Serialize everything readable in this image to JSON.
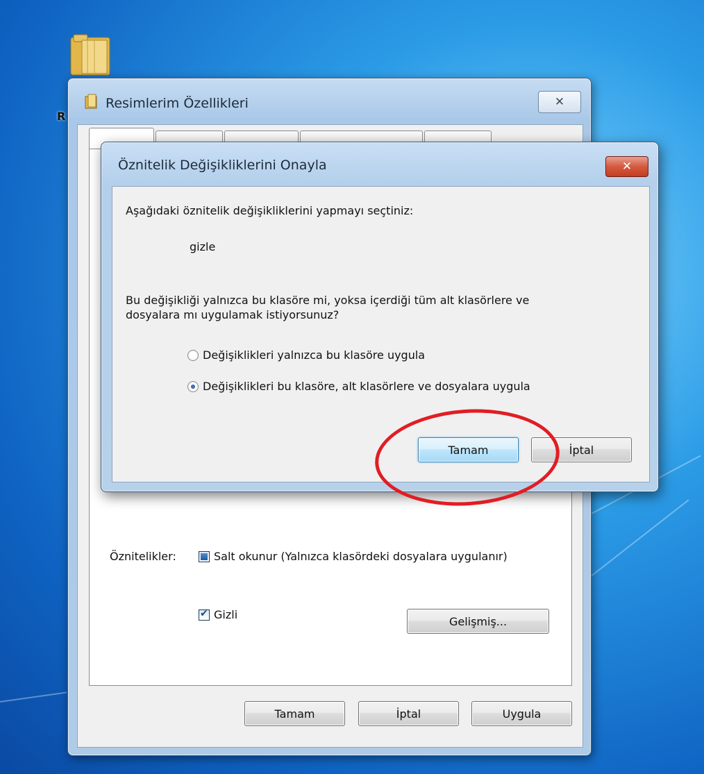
{
  "desktop": {
    "icon_label": "R"
  },
  "properties_window": {
    "title": "Resimlerim Özellikleri",
    "close_glyph": "✕",
    "attributes_label": "Öznitelikler:",
    "readonly_label": "Salt okunur (Yalnızca klasördeki dosyalara uygulanır)",
    "hidden_label": "Gizli",
    "advanced_label": "Gelişmiş...",
    "ok_label": "Tamam",
    "cancel_label": "İptal",
    "apply_label": "Uygula"
  },
  "confirm_dialog": {
    "title": "Öznitelik Değişikliklerini Onayla",
    "close_glyph": "✕",
    "intro": "Aşağıdaki öznitelik değişikliklerini yapmayı seçtiniz:",
    "change": "gizle",
    "question_line1": "Bu değişikliği yalnızca bu klasöre mi, yoksa içerdiği tüm alt klasörlere ve",
    "question_line2": "dosyalara mı uygulamak istiyorsunuz?",
    "option_folder_only": "Değişiklikleri yalnızca bu klasöre uygula",
    "option_all": "Değişiklikleri bu klasöre, alt klasörlere ve dosyalara uygula",
    "ok_label": "Tamam",
    "cancel_label": "İptal"
  },
  "colors": {
    "highlight_circle": "#e11d24"
  }
}
